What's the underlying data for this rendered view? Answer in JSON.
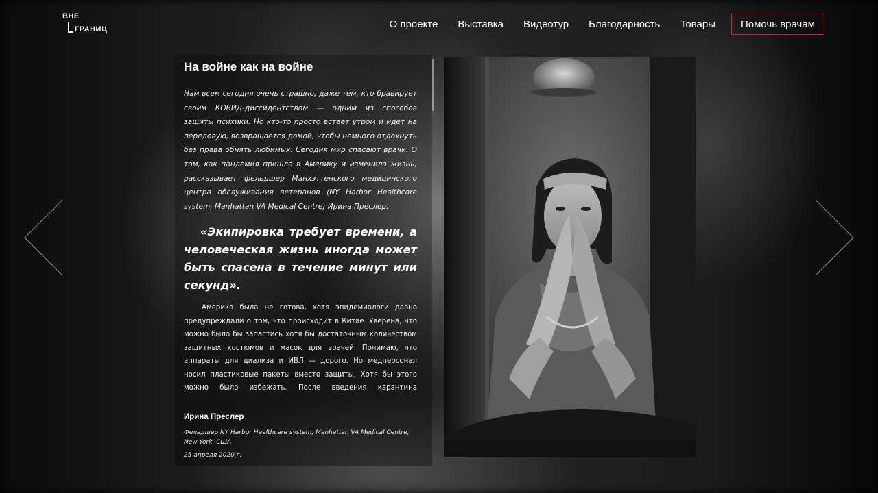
{
  "header": {
    "logo_top": "ВНЕ",
    "logo_bottom": "ГРАНИЦ",
    "nav": [
      {
        "label": "О проекте"
      },
      {
        "label": "Выставка"
      },
      {
        "label": "Видеотур"
      },
      {
        "label": "Благодарность"
      },
      {
        "label": "Товары"
      }
    ],
    "cta_label": "Помочь врачам",
    "cta_color": "#e0202a"
  },
  "article": {
    "title": "На войне как на войне",
    "lead": "Нам всем сегодня очень страшно, даже тем, кто бравирует своим КОВИД-диссидентством — одним из способов защиты психики. Но кто-то просто встает утром и идет на передовую, возвращается домой, чтобы немного отдохнуть без права обнять любимых. Сегодня мир спасают врачи. О том, как пандемия пришла в Америку и изменила жизнь, рассказывает фельдшер Манхэттенского медицинского центра обслуживания ветеранов (NY Harbor Healthcare system, Manhattan VA Medical Centre) Ирина Преслер.",
    "quote": "«Экипировка требует времени, а человеческая жизнь иногда может быть спасена в течение минут или секунд».",
    "body": "Америка была не готова, хотя эпидемиологи давно предупреждали о том, что происходит в Китае. Уверена, что можно было бы запастись хотя бы достаточным количеством защитных костюмов и масок для врачей. Понимаю, что аппараты для диализа и ИВЛ — дорого. Но медперсонал носил пластиковые пакеты вместо защиты. Хотя бы этого можно было избежать. После введения карантина поступление людей в инфекционные отделения стало снижаться. В последнюю неделю койки даже"
  },
  "signature": {
    "name": "Ирина Преслер",
    "role": "Фельдшер NY Harbor Healthcare system, Manhattan VA Medical Centre, New York, США",
    "date": "25 апреля 2020 г."
  },
  "icons": {
    "prev": "chevron-left-icon",
    "next": "chevron-right-icon"
  }
}
